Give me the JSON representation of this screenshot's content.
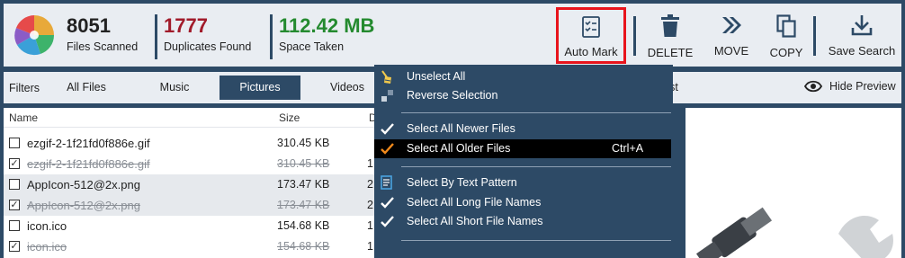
{
  "stats": {
    "files": {
      "value": "8051",
      "label": "Files Scanned"
    },
    "duplicates": {
      "value": "1777",
      "label": "Duplicates Found"
    },
    "space": {
      "value": "112.42 MB",
      "label": "Space Taken"
    }
  },
  "toolbar": {
    "auto_mark": "Auto Mark",
    "delete": "DELETE",
    "move": "MOVE",
    "copy": "COPY",
    "save_search": "Save Search"
  },
  "filters": {
    "label": "Filters",
    "tabs": [
      "All Files",
      "Music",
      "Pictures",
      "Videos",
      "st"
    ],
    "selected": "Pictures",
    "hide_preview": "Hide Preview"
  },
  "columns": {
    "name": "Name",
    "size": "Size",
    "date": "D"
  },
  "rows": [
    {
      "name": "ezgif-2-1f21fd0f886e.gif",
      "size": "310.45 KB",
      "date": "",
      "checked": false,
      "struck": false
    },
    {
      "name": "ezgif-2-1f21fd0f886e.gif",
      "size": "310.45 KB",
      "date": "1",
      "checked": true,
      "struck": true
    },
    {
      "name": "AppIcon-512@2x.png",
      "size": "173.47 KB",
      "date": "2",
      "checked": false,
      "struck": false
    },
    {
      "name": "AppIcon-512@2x.png",
      "size": "173.47 KB",
      "date": "2",
      "checked": true,
      "struck": true
    },
    {
      "name": "icon.ico",
      "size": "154.68 KB",
      "date": "1",
      "checked": false,
      "struck": false
    },
    {
      "name": "icon.ico",
      "size": "154.68 KB",
      "date": "1",
      "checked": true,
      "struck": true
    }
  ],
  "menu": {
    "unselect_all": "Unselect All",
    "reverse_selection": "Reverse Selection",
    "newer_files": "Select All Newer Files",
    "older_files": "Select All Older Files",
    "older_shortcut": "Ctrl+A",
    "text_pattern": "Select By Text Pattern",
    "long_names": "Select All Long File Names",
    "short_names": "Select All Short File Names"
  },
  "colors": {
    "accent_navy": "#2d4a66",
    "duplicates_red": "#a11b2a",
    "space_green": "#248a2f",
    "highlight_border": "#e8141c",
    "checkmark_orange": "#f08a1c"
  },
  "icons": [
    "pie-logo-icon",
    "checklist-icon",
    "trash-icon",
    "double-chevron-icon",
    "copy-icon",
    "download-icon",
    "eye-icon",
    "broom-icon",
    "reverse-icon",
    "check-icon",
    "text-pattern-icon"
  ]
}
